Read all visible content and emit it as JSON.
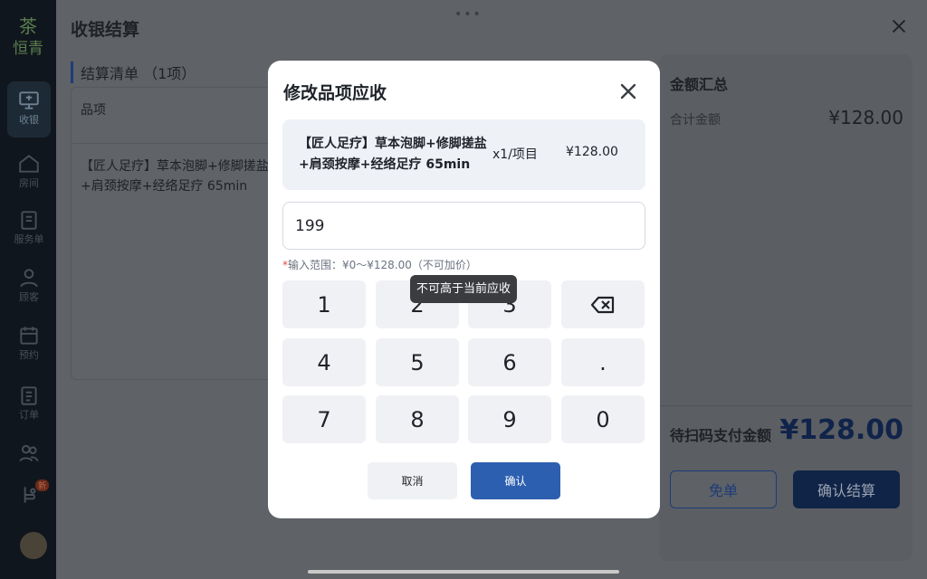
{
  "colors": {
    "accent": "#2d5fb0",
    "overlay": "#5f6266",
    "tooltip": "#3a3c40"
  },
  "sidebar": {
    "brand_mark": "茶",
    "brand_name": "恒青",
    "items": [
      {
        "label": "收银",
        "icon": "monitor-icon"
      },
      {
        "label": "房间",
        "icon": "home-icon"
      },
      {
        "label": "服务单",
        "icon": "clipboard-icon"
      },
      {
        "label": "顾客",
        "icon": "user-icon"
      },
      {
        "label": "预约",
        "icon": "calendar-icon"
      },
      {
        "label": "订单",
        "icon": "document-icon"
      },
      {
        "label": "",
        "icon": "users-icon"
      },
      {
        "label": "",
        "icon": "gift-icon",
        "badge": "新"
      }
    ]
  },
  "checkout": {
    "title": "收银结算",
    "drag_handle": "•••",
    "list_title": "结算清单 （1项）",
    "list_header": "品项",
    "list_item": "【匠人足疗】草本泡脚+修脚搓盐+肩颈按摩+经络足疗 65min",
    "summary": {
      "title": "金额汇总",
      "total_label": "合计金额",
      "total_value": "¥128.00",
      "pay_label": "待扫码支付金额",
      "pay_value": "¥128.00",
      "free_label": "免单",
      "settle_label": "确认结算"
    }
  },
  "modal": {
    "title": "修改品项应收",
    "item": {
      "name": "【匠人足疗】草本泡脚+修脚搓盐+肩颈按摩+经络足疗 65min",
      "qty": "x1/项目",
      "price": "¥128.00"
    },
    "input": {
      "value": "199",
      "placeholder": ""
    },
    "hint_star": "*",
    "hint": "输入范围：¥0～¥128.00（不可加价）",
    "tooltip": "不可高于当前应收",
    "keys": [
      "1",
      "2",
      "3",
      "",
      "4",
      "5",
      "6",
      ".",
      "7",
      "8",
      "9",
      "0"
    ],
    "cancel_label": "取消",
    "confirm_label": "确认"
  }
}
